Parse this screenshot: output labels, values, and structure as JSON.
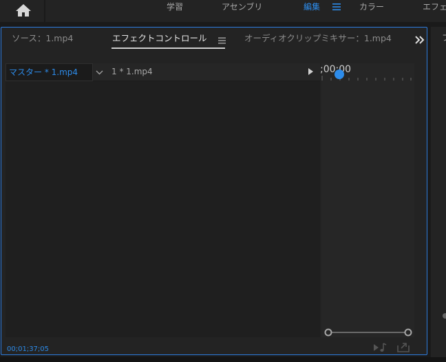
{
  "workspace": {
    "home_icon": "home-icon",
    "tabs": [
      {
        "label": "学習",
        "active": false
      },
      {
        "label": "アセンブリ",
        "active": false
      },
      {
        "label": "編集",
        "active": true
      },
      {
        "label": "カラー",
        "active": false
      },
      {
        "label": "エフェ",
        "active": false
      }
    ],
    "menu_icon": "hamburger-icon"
  },
  "panel": {
    "tabs": [
      {
        "label": "ソース：1.mp4",
        "active": false
      },
      {
        "label": "エフェクトコントロール",
        "active": true
      },
      {
        "label": "オーディオクリップミキサー：1.mp4",
        "active": false
      }
    ],
    "overflow_icon": "double-chevron-right-icon",
    "master_clip": "マスター * 1.mp4",
    "clip_name": "1 * 1.mp4",
    "timeline_timecode": ";00;00",
    "footer_timecode": "00;01;37;05"
  },
  "side_panel": {
    "label": "フ"
  },
  "colors": {
    "accent": "#2d8ceb",
    "panel_border": "#2d7de0",
    "background": "#1a1a1a"
  }
}
